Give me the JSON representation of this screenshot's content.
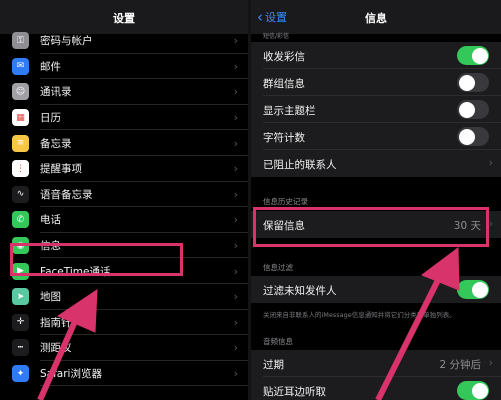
{
  "accent_color": "#d8336a",
  "settings": {
    "title": "设置",
    "items": [
      {
        "label": "密码与帐户",
        "icon": "key-icon",
        "color": "#8e8e93",
        "glyph": "⚿"
      },
      {
        "label": "邮件",
        "icon": "mail-icon",
        "color": "#2f7cf6",
        "glyph": "✉"
      },
      {
        "label": "通讯录",
        "icon": "contacts-icon",
        "color": "#a0a0a5",
        "glyph": "☺"
      },
      {
        "label": "日历",
        "icon": "calendar-icon",
        "color": "#ffffff",
        "glyph": "▦"
      },
      {
        "label": "备忘录",
        "icon": "notes-icon",
        "color": "#f7c644",
        "glyph": "≡"
      },
      {
        "label": "提醒事项",
        "icon": "reminders-icon",
        "color": "#ffffff",
        "glyph": "⋮"
      },
      {
        "label": "语音备忘录",
        "icon": "voice-memos-icon",
        "color": "#1c1c1e",
        "glyph": "∿"
      },
      {
        "label": "电话",
        "icon": "phone-icon",
        "color": "#34c759",
        "glyph": "✆"
      },
      {
        "label": "信息",
        "icon": "messages-icon",
        "color": "#34c759",
        "glyph": "◉"
      },
      {
        "label": "FaceTime通话",
        "icon": "facetime-icon",
        "color": "#34c759",
        "glyph": "▶"
      },
      {
        "label": "地图",
        "icon": "maps-icon",
        "color": "#5ac8a0",
        "glyph": "➤"
      },
      {
        "label": "指南针",
        "icon": "compass-icon",
        "color": "#1c1c1e",
        "glyph": "✛"
      },
      {
        "label": "测距仪",
        "icon": "measure-icon",
        "color": "#1c1c1e",
        "glyph": "┅"
      },
      {
        "label": "Safari浏览器",
        "icon": "safari-icon",
        "color": "#2f7cf6",
        "glyph": "✦"
      }
    ]
  },
  "messages": {
    "back_label": "设置",
    "title": "信息",
    "header_sms": "短信/彩信",
    "rows_top": [
      {
        "label": "收发彩信",
        "toggle": "on"
      },
      {
        "label": "群组信息",
        "toggle": "off"
      },
      {
        "label": "显示主题栏",
        "toggle": "off"
      },
      {
        "label": "字符计数",
        "toggle": "off"
      },
      {
        "label": "已阻止的联系人",
        "toggle": null
      }
    ],
    "header_history": "信息历史记录",
    "keep_messages": {
      "label": "保留信息",
      "value": "30 天"
    },
    "header_filter": "信息过滤",
    "filter_unknown": {
      "label": "过滤未知发件人",
      "toggle": "on"
    },
    "filter_note": "关闭来自非联系人的iMessage信息通知并将它们分类到单独列表。",
    "header_audio": "音频信息",
    "expire": {
      "label": "过期",
      "value": "2 分钟后"
    },
    "raise_to_listen": {
      "label": "贴近耳边听取",
      "toggle": "on"
    }
  }
}
